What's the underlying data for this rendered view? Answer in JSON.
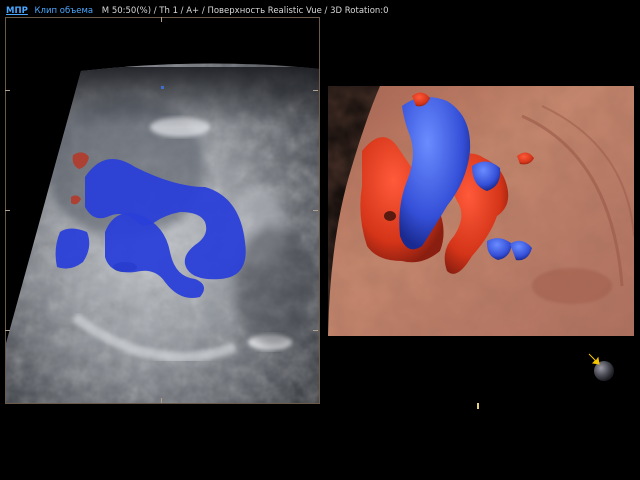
{
  "header": {
    "mode": "МПР",
    "clip": "Клип объема",
    "params": "M 50:50(%) / Th 1 / A+ / Поверхность Realistic Vue / 3D Rotation:0"
  },
  "colors": {
    "doppler_flow_blue": "#2a3fd8",
    "doppler_flow_red": "#e03a22",
    "surface_tissue": "#c7826a",
    "header_link": "#4aa8ff",
    "orientation_marker": "#f5c400"
  },
  "icons": {
    "orientation": "sphere-orientation-icon",
    "marker": "arrow-marker-icon"
  }
}
